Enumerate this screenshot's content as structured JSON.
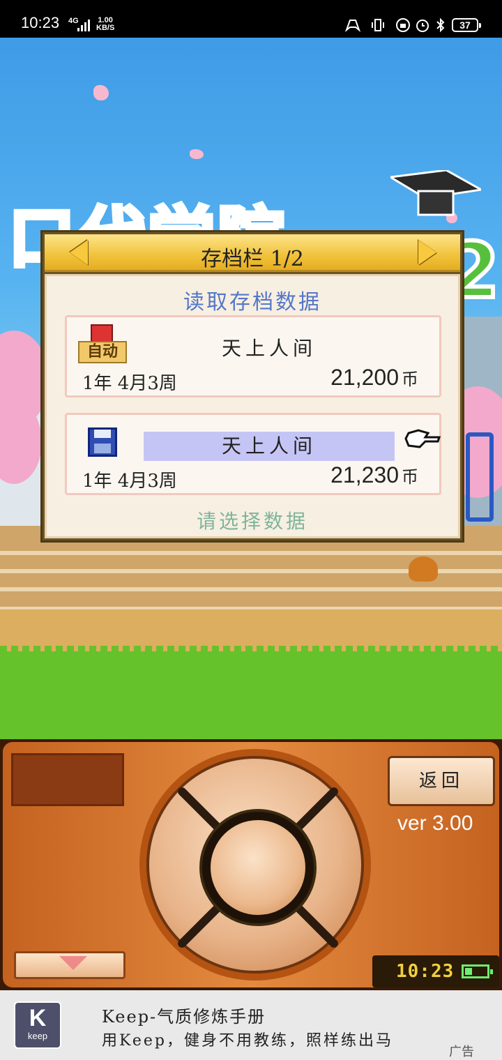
{
  "status_bar": {
    "time": "10:23",
    "network": "4G",
    "speed_value": "1.00",
    "speed_unit": "KB/S",
    "battery": "37"
  },
  "save_dialog": {
    "title": "存档栏 1/2",
    "heading": "读取存档数据",
    "slots": [
      {
        "badge": "自动",
        "name": "天上人间",
        "date": "1年 4月3周",
        "money": "21,200",
        "currency": "币",
        "selected": false
      },
      {
        "name": "天上人间",
        "date": "1年 4月3周",
        "money": "21,230",
        "currency": "币",
        "selected": true
      }
    ],
    "prompt": "请选择数据"
  },
  "control_panel": {
    "back_label": "返回",
    "version": "ver 3.00",
    "clock": "10:23"
  },
  "ad": {
    "logo_letter": "K",
    "logo_text": "keep",
    "title": "Keep-气质修炼手册",
    "description": "用Keep，健身不用教练，照样练出马",
    "badge": "广告"
  },
  "colors": {
    "sky": "#57b3f0",
    "dialog_header": "#f0c23b",
    "heading_blue": "#5577c8",
    "selected_row": "#c5c5f5",
    "panel_orange": "#e38a3f",
    "grass": "#66c22a"
  }
}
